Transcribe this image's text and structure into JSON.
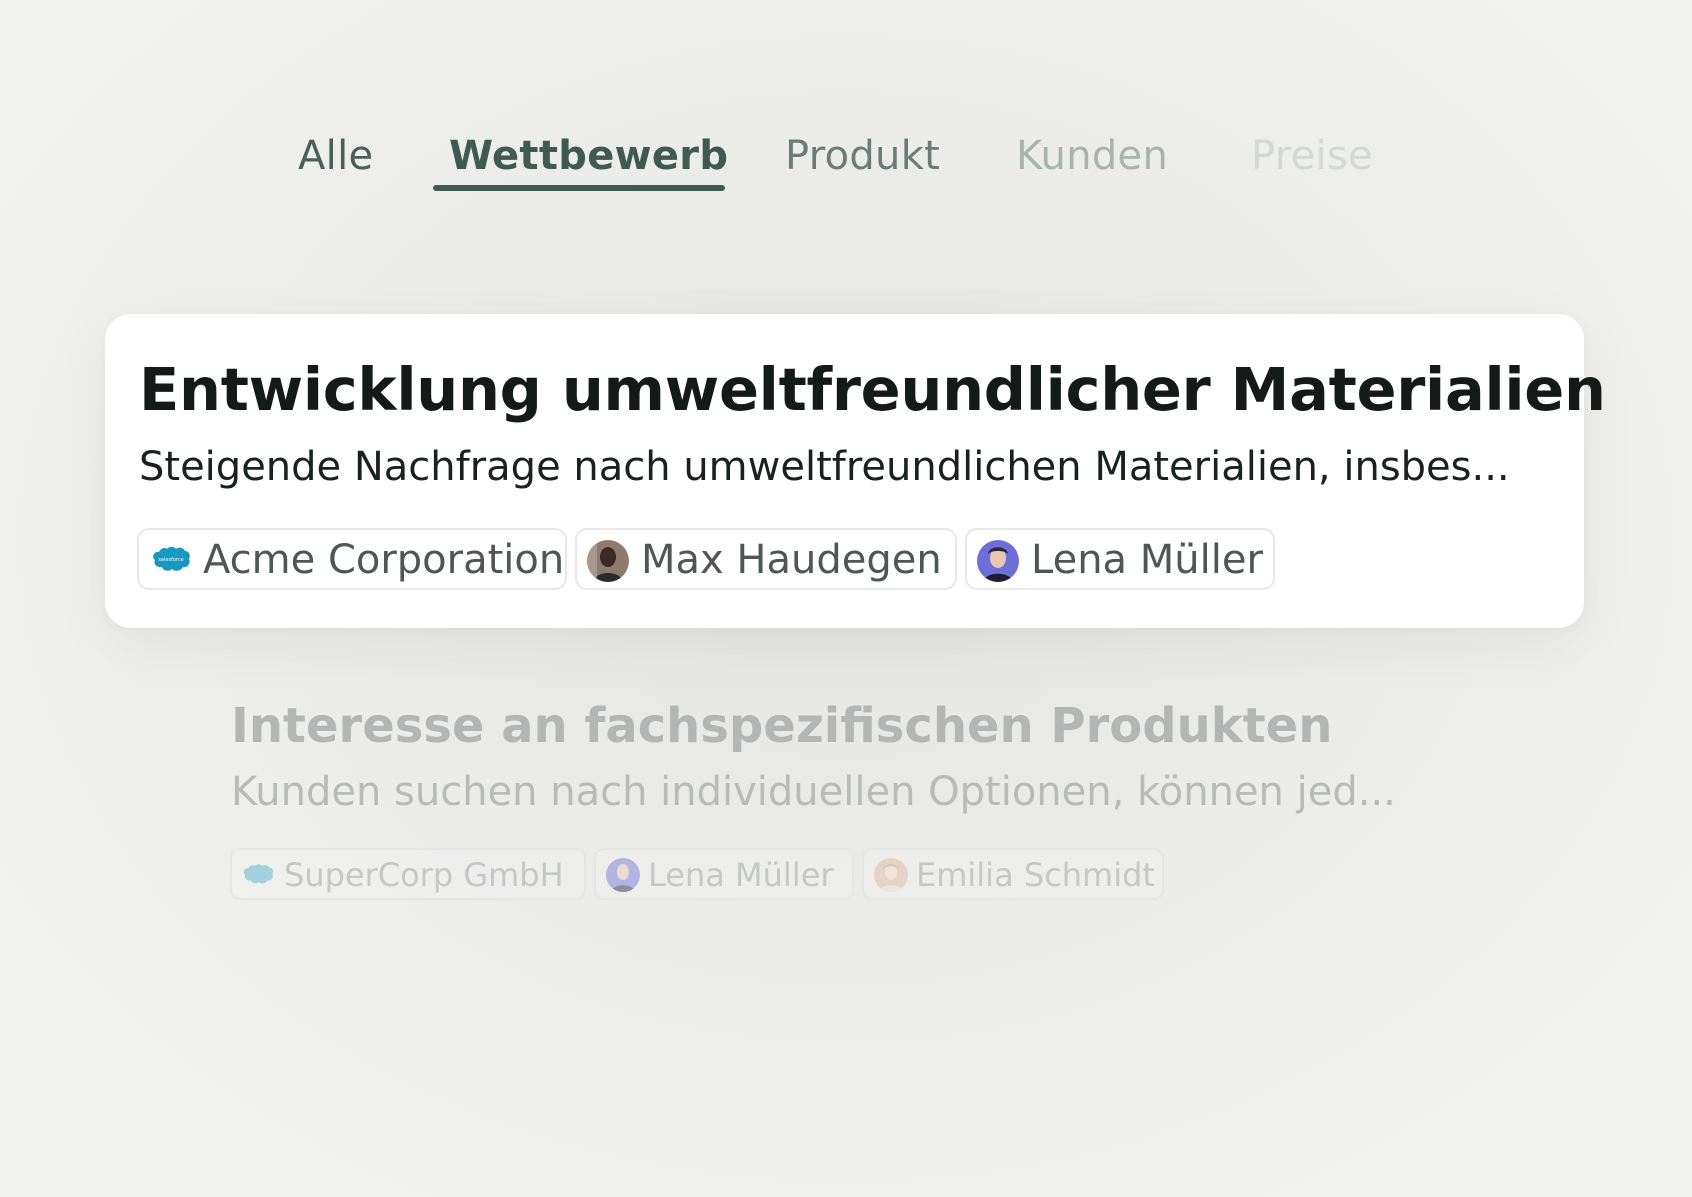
{
  "tabs": [
    {
      "label": "Alle"
    },
    {
      "label": "Wettbewerb",
      "active": true
    },
    {
      "label": "Produkt"
    },
    {
      "label": "Kunden"
    },
    {
      "label": "Preise"
    }
  ],
  "items": [
    {
      "title": "Entwicklung umweltfreundlicher Materialien",
      "description": "Steigende Nachfrage nach umweltfreundlichen Materialien, insbes...",
      "tags": [
        {
          "label": "Acme Corporation",
          "icon": "salesforce-icon"
        },
        {
          "label": "Max Haudegen",
          "icon": "avatar"
        },
        {
          "label": "Lena Müller",
          "icon": "avatar"
        }
      ]
    },
    {
      "title": "Interesse an fachspezifischen Produkten",
      "description": "Kunden suchen nach individuellen Optionen, können jed...",
      "tags": [
        {
          "label": "SuperCorp GmbH",
          "icon": "salesforce-icon"
        },
        {
          "label": "Lena Müller",
          "icon": "avatar"
        },
        {
          "label": "Emilia Schmidt",
          "icon": "avatar"
        }
      ]
    }
  ],
  "colors": {
    "accent": "#3f5a53",
    "salesforce": "#1798c1",
    "background": "#ededeb"
  }
}
